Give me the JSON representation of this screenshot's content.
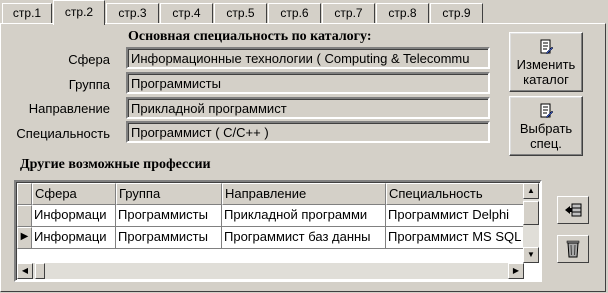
{
  "tabs": [
    "стр.1",
    "стр.2",
    "стр.3",
    "стр.4",
    "стр.5",
    "стр.6",
    "стр.7",
    "стр.8",
    "стр.9"
  ],
  "active_tab": 1,
  "main": {
    "heading": "Основная специальность по каталогу:",
    "fields": [
      {
        "label": "Сфера",
        "value": "Информационные технологии ( Computing & Telecommu"
      },
      {
        "label": "Группа",
        "value": "Программисты"
      },
      {
        "label": "Направление",
        "value": "Прикладной программист"
      },
      {
        "label": "Специальность",
        "value": "Программист ( C/C++ )"
      }
    ]
  },
  "buttons": {
    "change_catalog": "Изменить каталог",
    "select_spec": "Выбрать спец."
  },
  "other": {
    "heading": "Другие возможные профессии",
    "columns": [
      "Сфера",
      "Группа",
      "Направление",
      "Специальность"
    ],
    "rows": [
      [
        "Информаци",
        "Программисты",
        "Прикладной программи",
        "Программист Delphi"
      ],
      [
        "Информаци",
        "Программисты",
        "Программист баз данны",
        "Программист MS SQL"
      ]
    ],
    "current_row_marker": "▶"
  },
  "icons": {
    "change_catalog": "document-edit-icon",
    "select_spec": "document-edit-icon",
    "add": "insert-row-icon",
    "delete": "recycle-bin-icon"
  }
}
